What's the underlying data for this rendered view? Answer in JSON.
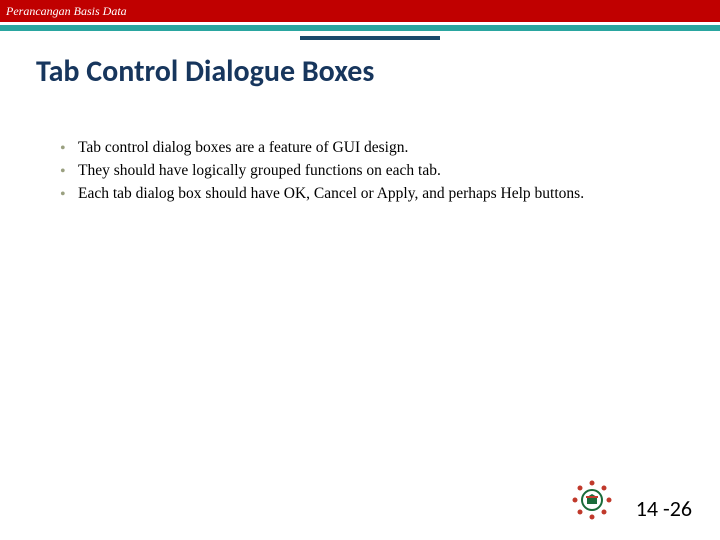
{
  "header": {
    "course_title": "Perancangan Basis Data"
  },
  "slide": {
    "title": "Tab Control Dialogue Boxes",
    "bullets": [
      "Tab control dialog boxes are a feature of GUI design.",
      "They should have logically grouped functions on each tab.",
      "Each tab dialog box should have OK, Cancel or Apply, and perhaps Help buttons."
    ],
    "page_number": "14 -26"
  },
  "colors": {
    "red": "#c00000",
    "teal": "#2aa6a0",
    "navy": "#17365d",
    "accent": "#1b4a6b"
  }
}
